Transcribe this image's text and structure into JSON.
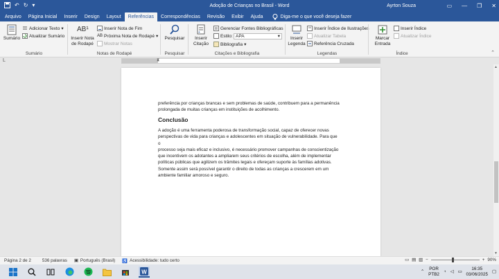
{
  "window": {
    "title": "Adoção de Crianças no Brasil - Word",
    "user": "Ayrton Souza"
  },
  "tabs": [
    "Arquivo",
    "Página Inicial",
    "Inserir",
    "Design",
    "Layout",
    "Referências",
    "Correspondências",
    "Revisão",
    "Exibir",
    "Ajuda"
  ],
  "tell_me": "Diga-me o que você deseja fazer",
  "ribbon": {
    "sumario": {
      "label": "Sumário",
      "big": "Sumário",
      "add_text": "Adicionar Texto",
      "update": "Atualizar Sumário"
    },
    "notas": {
      "label": "Notas de Rodapé",
      "big": "Inserir Nota de Rodapé",
      "insert_end": "Inserir Nota de Fim",
      "next": "Próxima Nota de Rodapé",
      "show": "Mostrar Notas"
    },
    "pesquisar": {
      "label": "Pesquisar",
      "big": "Pesquisar"
    },
    "citacoes": {
      "label": "Citações e Bibliografia",
      "big": "Inserir Citação",
      "manage": "Gerenciar Fontes Bibliográficas",
      "style_label": "Estilo:",
      "style_value": "APA",
      "biblio": "Bibliografia"
    },
    "legendas": {
      "label": "Legendas",
      "big": "Inserir Legenda",
      "insert_index": "Inserir Índice de Ilustrações",
      "update_table": "Atualizar Tabela",
      "cross_ref": "Referência Cruzada"
    },
    "indice": {
      "label": "Índice",
      "big": "Marcar Entrada",
      "insert": "Inserir Índice",
      "update": "Atualizar Índice"
    }
  },
  "document": {
    "para1_line1": "preferência por crianças brancas e sem problemas de saúde, contribuem para a permanência",
    "para1_line2": "prolongada de muitas crianças em instituições de acolhimento.",
    "heading": "Conclusão",
    "para2": [
      "A adoção é uma ferramenta poderosa de transformação social, capaz de oferecer novas",
      "perspectivas de vida para crianças e adolescentes em situação de vulnerabilidade. Para que o",
      "processo seja mais eficaz e inclusivo, é necessário promover campanhas de conscientização",
      "que incentivem os adotantes a ampliarem seus critérios de escolha, além de implementar",
      "políticas públicas que agilizem os trâmites legais e ofereçam suporte às famílias adotivas.",
      "Somente assim será possível garantir o direito de todas as crianças a crescerem em um",
      "ambiente familiar amoroso e seguro."
    ]
  },
  "status": {
    "page": "Página 2 de 2",
    "words": "536 palavras",
    "language": "Português (Brasil)",
    "accessibility": "Acessibilidade: tudo certo",
    "zoom": "90%"
  },
  "taskbar": {
    "lang1": "POR",
    "lang2": "PTB2",
    "time": "16:35",
    "date": "03/06/2025"
  },
  "colors": {
    "word_blue": "#2b579a"
  }
}
